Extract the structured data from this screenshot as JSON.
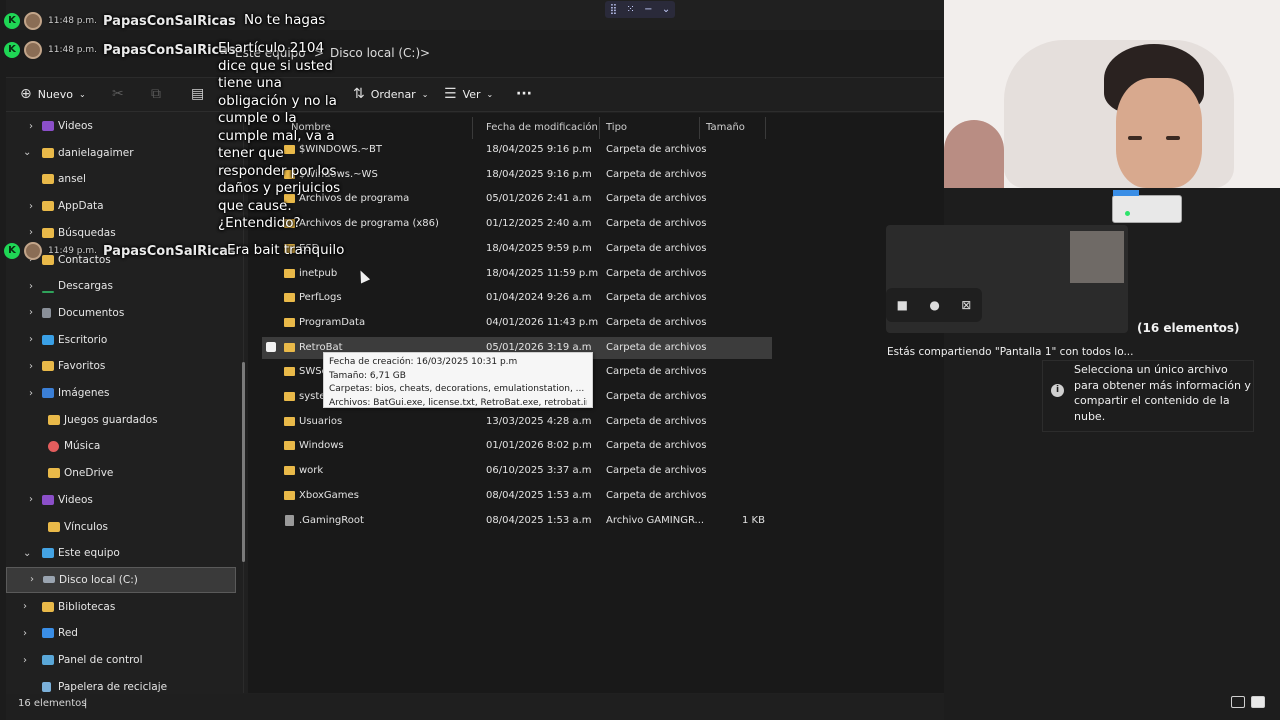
{
  "chat": [
    {
      "time": "11:48 p.m.",
      "user": "PapasConSalRicas",
      "message": "No te hagas"
    },
    {
      "time": "11:48 p.m.",
      "user": "PapasConSalRicas",
      "message": "El artículo 2104 dice que si usted tiene una obligación y no la cumple o la cumple mal, va a tener que responder por los daños y perjuicios que cause. ¿Entendido?"
    },
    {
      "time": "11:49 p.m.",
      "user": "PapasConSalRicas",
      "message": "Era bait tranquilo"
    }
  ],
  "chat_badge": "K",
  "address": {
    "crumbs": [
      "Este equipo",
      "Disco local (C:)"
    ],
    "sep": ">"
  },
  "toolbar": {
    "new_label": "Nuevo",
    "sort_label": "Ordenar",
    "view_label": "Ver",
    "more_label": "···"
  },
  "sidebar": {
    "items": [
      {
        "label": "Videos",
        "icon": "videos-icon",
        "chev": ">"
      },
      {
        "label": "danielagaimer",
        "icon": "folder-icon",
        "chev": "v"
      },
      {
        "label": "ansel",
        "icon": "folder-icon",
        "chev": ""
      },
      {
        "label": "AppData",
        "icon": "folder-icon",
        "chev": ">"
      },
      {
        "label": "Búsquedas",
        "icon": "folder-icon",
        "chev": ">"
      },
      {
        "label": "Contactos",
        "icon": "folder-icon",
        "chev": ">"
      },
      {
        "label": "Descargas",
        "icon": "download-icon",
        "chev": ">"
      },
      {
        "label": "Documentos",
        "icon": "document-icon",
        "chev": ">"
      },
      {
        "label": "Escritorio",
        "icon": "desktop-icon",
        "chev": ">"
      },
      {
        "label": "Favoritos",
        "icon": "folder-icon",
        "chev": ">"
      },
      {
        "label": "Imágenes",
        "icon": "pictures-icon",
        "chev": ">"
      },
      {
        "label": "Juegos guardados",
        "icon": "folder-icon",
        "chev": ""
      },
      {
        "label": "Música",
        "icon": "music-icon",
        "chev": ""
      },
      {
        "label": "OneDrive",
        "icon": "folder-icon",
        "chev": ""
      },
      {
        "label": "Videos",
        "icon": "videos-icon",
        "chev": ">"
      },
      {
        "label": "Vínculos",
        "icon": "folder-icon",
        "chev": ""
      },
      {
        "label": "Este equipo",
        "icon": "computer-icon",
        "chev": "v"
      },
      {
        "label": "Disco local (C:)",
        "icon": "drive-icon",
        "chev": ">"
      },
      {
        "label": "Bibliotecas",
        "icon": "folder-icon",
        "chev": ">"
      },
      {
        "label": "Red",
        "icon": "network-icon",
        "chev": ">"
      },
      {
        "label": "Panel de control",
        "icon": "control-panel-icon",
        "chev": ">"
      },
      {
        "label": "Papelera de reciclaje",
        "icon": "recycle-bin-icon",
        "chev": ""
      }
    ]
  },
  "columns": {
    "name": "Nombre",
    "modified": "Fecha de modificación",
    "type": "Tipo",
    "size": "Tamaño"
  },
  "files": [
    {
      "name": "$WINDOWS.~BT",
      "date": "18/04/2025 9:16 p.m",
      "type": "Carpeta de archivos",
      "size": ""
    },
    {
      "name": "$Windows.~WS",
      "date": "18/04/2025 9:16 p.m",
      "type": "Carpeta de archivos",
      "size": ""
    },
    {
      "name": "Archivos de programa",
      "date": "05/01/2026 2:41 a.m",
      "type": "Carpeta de archivos",
      "size": ""
    },
    {
      "name": "Archivos de programa (x86)",
      "date": "01/12/2025 2:40 a.m",
      "type": "Carpeta de archivos",
      "size": ""
    },
    {
      "name": "ESD",
      "date": "18/04/2025 9:59 p.m",
      "type": "Carpeta de archivos",
      "size": ""
    },
    {
      "name": "inetpub",
      "date": "18/04/2025 11:59 p.m",
      "type": "Carpeta de archivos",
      "size": ""
    },
    {
      "name": "PerfLogs",
      "date": "01/04/2024 9:26 a.m",
      "type": "Carpeta de archivos",
      "size": ""
    },
    {
      "name": "ProgramData",
      "date": "04/01/2026 11:43 p.m",
      "type": "Carpeta de archivos",
      "size": ""
    },
    {
      "name": "RetroBat",
      "date": "05/01/2026 3:19 a.m",
      "type": "Carpeta de archivos",
      "size": ""
    },
    {
      "name": "SWSetup",
      "date": "",
      "type": "Carpeta de archivos",
      "size": ""
    },
    {
      "name": "system",
      "date": "",
      "type": "Carpeta de archivos",
      "size": ""
    },
    {
      "name": "Usuarios",
      "date": "13/03/2025 4:28 a.m",
      "type": "Carpeta de archivos",
      "size": ""
    },
    {
      "name": "Windows",
      "date": "01/01/2026 8:02 p.m",
      "type": "Carpeta de archivos",
      "size": ""
    },
    {
      "name": "work",
      "date": "06/10/2025 3:37 a.m",
      "type": "Carpeta de archivos",
      "size": ""
    },
    {
      "name": "XboxGames",
      "date": "08/04/2025 1:53 a.m",
      "type": "Carpeta de archivos",
      "size": ""
    },
    {
      "name": ".GamingRoot",
      "date": "08/04/2025 1:53 a.m",
      "type": "Archivo GAMINGR...",
      "size": "1 KB"
    }
  ],
  "tooltip": {
    "created": "Fecha de creación: 16/03/2025 10:31 p.m",
    "size": "Tamaño: 6,71 GB",
    "folders": "Carpetas: bios, cheats, decorations, emulationstation, ...",
    "files": "Archivos: BatGui.exe, license.txt, RetroBat.exe, retrobat.ini, ..."
  },
  "status": {
    "count": "16 elementos",
    "sep": "|"
  },
  "details": {
    "count": "(16 elementos)",
    "info": "Selecciona un único archivo para obtener más información y compartir el contenido de la nube.",
    "info_icon": "i"
  },
  "share": {
    "text": "Estás compartiendo \"Pantalla 1\" con todos lo..."
  }
}
